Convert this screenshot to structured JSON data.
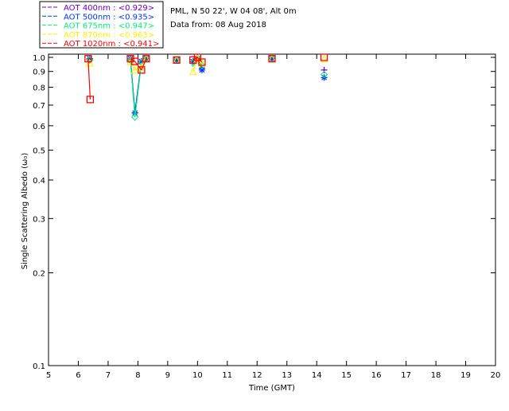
{
  "chart_data": {
    "type": "scatter",
    "header": {
      "site": "PML, N 50 22', W 04 08', Alt 0m",
      "date": "Data from: 08 Aug 2018"
    },
    "xlabel": "Time (GMT)",
    "ylabel": "Single Scattering Albedo (ω₀)",
    "xlim": [
      5,
      20
    ],
    "ylim": [
      0.1,
      1.0
    ],
    "yscale": "log",
    "xticks": [
      "5",
      "6",
      "7",
      "8",
      "9",
      "10",
      "11",
      "12",
      "13",
      "14",
      "15",
      "16",
      "17",
      "18",
      "19",
      "20"
    ],
    "yticks": [
      "0.1",
      "0.2",
      "0.3",
      "0.4",
      "0.5",
      "0.6",
      "0.7",
      "0.8",
      "0.9",
      "1.0"
    ],
    "legend_position": "top-left",
    "series": [
      {
        "name": "AOT  400nm : <0.929>",
        "color": "#6a00c8",
        "marker": "plus",
        "x": [
          6.38,
          7.75,
          7.9,
          8.12,
          8.28,
          9.3,
          9.85,
          10.0,
          10.15,
          12.5,
          14.25
        ],
        "y": [
          0.99,
          0.99,
          0.66,
          0.97,
          0.99,
          0.98,
          0.97,
          0.99,
          0.92,
          0.99,
          0.91
        ]
      },
      {
        "name": "AOT  500nm : <0.935>",
        "color": "#0033ff",
        "marker": "asterisk",
        "x": [
          6.38,
          7.75,
          7.9,
          8.12,
          8.28,
          9.3,
          9.85,
          10.0,
          10.15,
          12.5,
          14.25
        ],
        "y": [
          0.99,
          0.99,
          0.66,
          0.97,
          0.99,
          0.98,
          0.97,
          0.99,
          0.91,
          0.99,
          0.86
        ]
      },
      {
        "name": "AOT  675nm : <0.947>",
        "color": "#00ee77",
        "marker": "diamond",
        "x": [
          6.38,
          7.75,
          7.9,
          8.12,
          8.28,
          9.3,
          9.85,
          10.0,
          10.15,
          12.5,
          14.25
        ],
        "y": [
          0.98,
          0.98,
          0.64,
          0.96,
          0.99,
          0.98,
          0.96,
          0.99,
          0.94,
          0.99,
          0.88
        ]
      },
      {
        "name": "AOT  870nm : <0.963>",
        "color": "#ffee00",
        "marker": "triangle",
        "x": [
          6.38,
          7.75,
          7.9,
          8.12,
          8.28,
          9.3,
          9.85,
          10.0,
          10.15,
          12.5,
          14.25
        ],
        "y": [
          0.96,
          0.97,
          0.91,
          0.93,
          0.99,
          0.98,
          0.9,
          0.99,
          0.96,
          0.99,
          0.99
        ]
      },
      {
        "name": "AOT 1020nm : <0.941>",
        "color": "#ff0000",
        "marker": "square",
        "x": [
          6.33,
          6.4,
          7.75,
          7.9,
          8.12,
          8.28,
          9.3,
          9.85,
          10.0,
          10.15,
          12.5,
          14.25
        ],
        "y": [
          0.99,
          0.73,
          0.99,
          0.97,
          0.91,
          0.99,
          0.98,
          0.98,
          1.0,
          0.965,
          0.99,
          1.0
        ]
      }
    ]
  }
}
